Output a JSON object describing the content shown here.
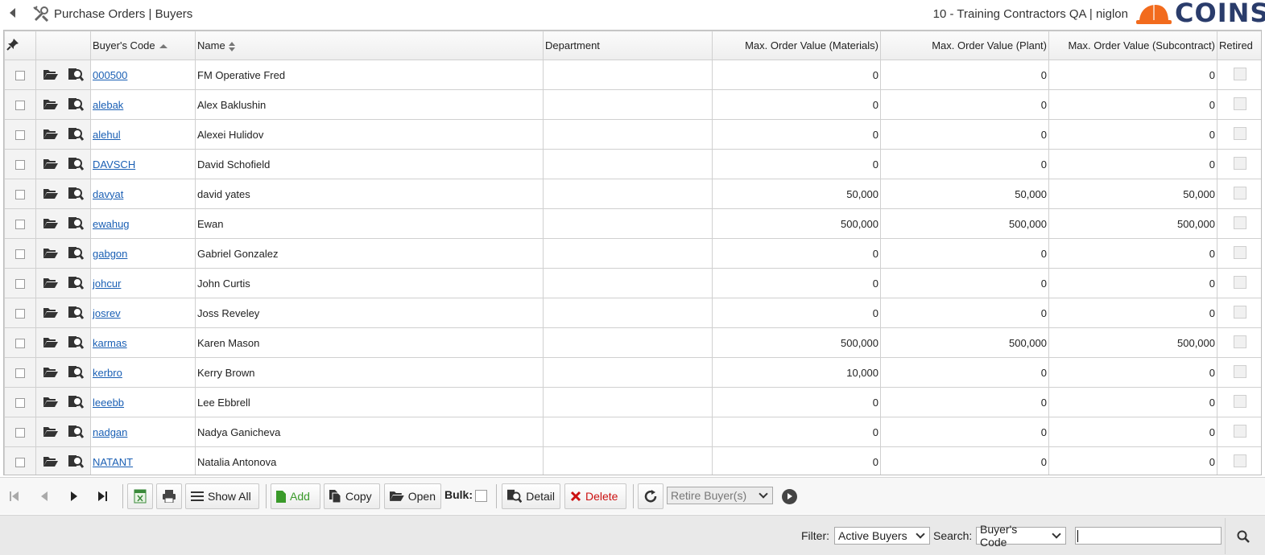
{
  "header": {
    "title": "Purchase Orders | Buyers",
    "context": "10 - Training Contractors QA | niglon",
    "logo_text": "COINS",
    "logo_color": "#f26b1d"
  },
  "grid": {
    "columns": {
      "code": "Buyer's Code",
      "name": "Name",
      "department": "Department",
      "max_materials": "Max. Order Value (Materials)",
      "max_plant": "Max. Order Value (Plant)",
      "max_subcontract": "Max. Order Value (Subcontract)",
      "retired": "Retired"
    },
    "rows": [
      {
        "code": "000500",
        "name": "FM Operative Fred",
        "department": "",
        "materials": "0",
        "plant": "0",
        "subcontract": "0"
      },
      {
        "code": "alebak",
        "name": "Alex Baklushin",
        "department": "",
        "materials": "0",
        "plant": "0",
        "subcontract": "0"
      },
      {
        "code": "alehul",
        "name": "Alexei Hulidov",
        "department": "",
        "materials": "0",
        "plant": "0",
        "subcontract": "0"
      },
      {
        "code": "DAVSCH",
        "name": "David Schofield",
        "department": "",
        "materials": "0",
        "plant": "0",
        "subcontract": "0"
      },
      {
        "code": "davyat",
        "name": "david yates",
        "department": "",
        "materials": "50,000",
        "plant": "50,000",
        "subcontract": "50,000"
      },
      {
        "code": "ewahug",
        "name": "Ewan",
        "department": "",
        "materials": "500,000",
        "plant": "500,000",
        "subcontract": "500,000"
      },
      {
        "code": "gabgon",
        "name": "Gabriel Gonzalez",
        "department": "",
        "materials": "0",
        "plant": "0",
        "subcontract": "0"
      },
      {
        "code": "johcur",
        "name": "John Curtis",
        "department": "",
        "materials": "0",
        "plant": "0",
        "subcontract": "0"
      },
      {
        "code": "josrev",
        "name": "Joss Reveley",
        "department": "",
        "materials": "0",
        "plant": "0",
        "subcontract": "0"
      },
      {
        "code": "karmas",
        "name": "Karen Mason",
        "department": "",
        "materials": "500,000",
        "plant": "500,000",
        "subcontract": "500,000"
      },
      {
        "code": "kerbro",
        "name": "Kerry Brown",
        "department": "",
        "materials": "10,000",
        "plant": "0",
        "subcontract": "0"
      },
      {
        "code": "leeebb",
        "name": "Lee Ebbrell",
        "department": "",
        "materials": "0",
        "plant": "0",
        "subcontract": "0"
      },
      {
        "code": "nadgan",
        "name": "Nadya Ganicheva",
        "department": "",
        "materials": "0",
        "plant": "0",
        "subcontract": "0"
      },
      {
        "code": "NATANT",
        "name": "Natalia Antonova",
        "department": "",
        "materials": "0",
        "plant": "0",
        "subcontract": "0"
      }
    ]
  },
  "toolbar": {
    "show_all": "Show All",
    "add": "Add",
    "copy": "Copy",
    "open": "Open",
    "bulk": "Bulk:",
    "detail": "Detail",
    "delete": "Delete",
    "retire_select": "Retire Buyer(s)"
  },
  "filterbar": {
    "filter_label": "Filter:",
    "filter_value": "Active Buyers",
    "search_label": "Search:",
    "search_field": "Buyer's Code",
    "search_value": ""
  }
}
